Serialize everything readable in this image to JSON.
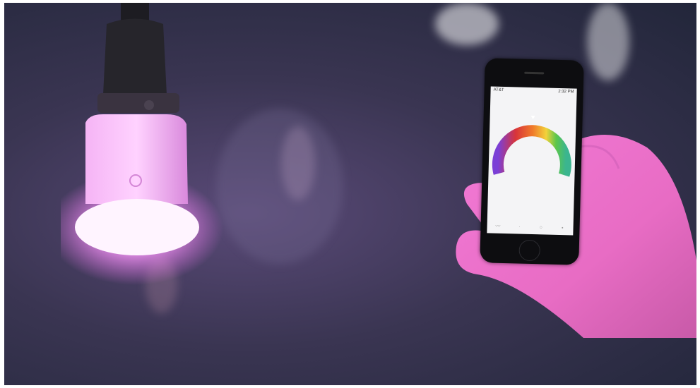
{
  "scene": {
    "description_tags": [
      "lamp-bulb",
      "smartphone",
      "hand"
    ],
    "bulb_color": "#f0a0f0",
    "glow_color": "#ff78ff",
    "background_tone": "#2c2f45"
  },
  "phone": {
    "status_left": "AT&T",
    "status_time": "2:32 PM",
    "tabs": [
      "",
      "",
      "",
      ""
    ],
    "wheel_colors": [
      "#7b3fd6",
      "#d8343a",
      "#f07a2a",
      "#f2d23b",
      "#5cc64a",
      "#3bb58f"
    ]
  }
}
